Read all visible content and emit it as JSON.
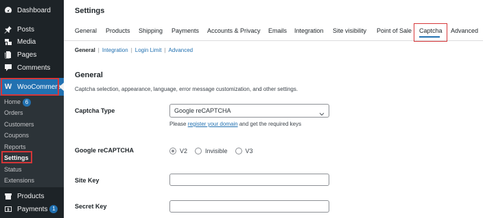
{
  "sidebar": {
    "items": [
      {
        "label": "Dashboard",
        "icon": "dashboard-icon"
      },
      {
        "label": "Posts",
        "icon": "pin-icon"
      },
      {
        "label": "Media",
        "icon": "media-icon"
      },
      {
        "label": "Pages",
        "icon": "pages-icon"
      },
      {
        "label": "Comments",
        "icon": "comments-icon"
      },
      {
        "label": "WooCommerce",
        "icon": "woocommerce-icon"
      },
      {
        "label": "Products",
        "icon": "products-icon"
      },
      {
        "label": "Payments",
        "icon": "payments-icon",
        "badge": "1"
      }
    ],
    "submenu": [
      {
        "label": "Home",
        "badge": "6"
      },
      {
        "label": "Orders"
      },
      {
        "label": "Customers"
      },
      {
        "label": "Coupons"
      },
      {
        "label": "Reports"
      },
      {
        "label": "Settings"
      },
      {
        "label": "Status"
      },
      {
        "label": "Extensions"
      }
    ]
  },
  "header": {
    "title": "Settings"
  },
  "tabs": [
    "General",
    "Products",
    "Shipping",
    "Payments",
    "Accounts & Privacy",
    "Emails",
    "Integration",
    "Site visibility",
    "Point of Sale",
    "Captcha",
    "Advanced"
  ],
  "active_tab": "Captcha",
  "subnav": {
    "general": "General",
    "integration": "Integration",
    "login_limit": "Login Limit",
    "advanced": "Advanced",
    "separator": "|"
  },
  "section": {
    "title": "General",
    "description": "Captcha selection, appearance, language, error message customization, and other settings."
  },
  "fields": {
    "captcha_type": {
      "label": "Captcha Type",
      "value": "Google reCAPTCHA",
      "hint_prefix": "Please ",
      "hint_link": "register your domain",
      "hint_suffix": " and get the required keys"
    },
    "google_recaptcha": {
      "label": "Google reCAPTCHA",
      "options": [
        "V2",
        "Invisible",
        "V3"
      ],
      "selected": "V2"
    },
    "site_key": {
      "label": "Site Key",
      "value": ""
    },
    "secret_key": {
      "label": "Secret Key",
      "value": ""
    }
  },
  "colors": {
    "sidebar_bg": "#1d2327",
    "accent": "#2271b1",
    "highlight_outline": "#d63638"
  }
}
